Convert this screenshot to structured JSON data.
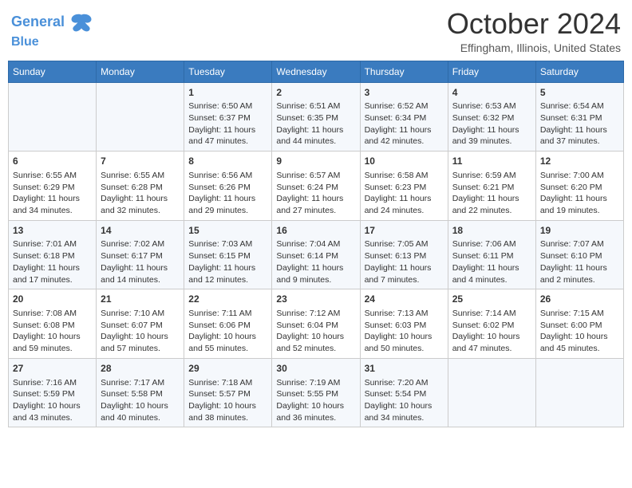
{
  "header": {
    "logo_line1": "General",
    "logo_line2": "Blue",
    "month_title": "October 2024",
    "location": "Effingham, Illinois, United States"
  },
  "days_of_week": [
    "Sunday",
    "Monday",
    "Tuesday",
    "Wednesday",
    "Thursday",
    "Friday",
    "Saturday"
  ],
  "weeks": [
    [
      {
        "day": "",
        "data": ""
      },
      {
        "day": "",
        "data": ""
      },
      {
        "day": "1",
        "data": "Sunrise: 6:50 AM\nSunset: 6:37 PM\nDaylight: 11 hours and 47 minutes."
      },
      {
        "day": "2",
        "data": "Sunrise: 6:51 AM\nSunset: 6:35 PM\nDaylight: 11 hours and 44 minutes."
      },
      {
        "day": "3",
        "data": "Sunrise: 6:52 AM\nSunset: 6:34 PM\nDaylight: 11 hours and 42 minutes."
      },
      {
        "day": "4",
        "data": "Sunrise: 6:53 AM\nSunset: 6:32 PM\nDaylight: 11 hours and 39 minutes."
      },
      {
        "day": "5",
        "data": "Sunrise: 6:54 AM\nSunset: 6:31 PM\nDaylight: 11 hours and 37 minutes."
      }
    ],
    [
      {
        "day": "6",
        "data": "Sunrise: 6:55 AM\nSunset: 6:29 PM\nDaylight: 11 hours and 34 minutes."
      },
      {
        "day": "7",
        "data": "Sunrise: 6:55 AM\nSunset: 6:28 PM\nDaylight: 11 hours and 32 minutes."
      },
      {
        "day": "8",
        "data": "Sunrise: 6:56 AM\nSunset: 6:26 PM\nDaylight: 11 hours and 29 minutes."
      },
      {
        "day": "9",
        "data": "Sunrise: 6:57 AM\nSunset: 6:24 PM\nDaylight: 11 hours and 27 minutes."
      },
      {
        "day": "10",
        "data": "Sunrise: 6:58 AM\nSunset: 6:23 PM\nDaylight: 11 hours and 24 minutes."
      },
      {
        "day": "11",
        "data": "Sunrise: 6:59 AM\nSunset: 6:21 PM\nDaylight: 11 hours and 22 minutes."
      },
      {
        "day": "12",
        "data": "Sunrise: 7:00 AM\nSunset: 6:20 PM\nDaylight: 11 hours and 19 minutes."
      }
    ],
    [
      {
        "day": "13",
        "data": "Sunrise: 7:01 AM\nSunset: 6:18 PM\nDaylight: 11 hours and 17 minutes."
      },
      {
        "day": "14",
        "data": "Sunrise: 7:02 AM\nSunset: 6:17 PM\nDaylight: 11 hours and 14 minutes."
      },
      {
        "day": "15",
        "data": "Sunrise: 7:03 AM\nSunset: 6:15 PM\nDaylight: 11 hours and 12 minutes."
      },
      {
        "day": "16",
        "data": "Sunrise: 7:04 AM\nSunset: 6:14 PM\nDaylight: 11 hours and 9 minutes."
      },
      {
        "day": "17",
        "data": "Sunrise: 7:05 AM\nSunset: 6:13 PM\nDaylight: 11 hours and 7 minutes."
      },
      {
        "day": "18",
        "data": "Sunrise: 7:06 AM\nSunset: 6:11 PM\nDaylight: 11 hours and 4 minutes."
      },
      {
        "day": "19",
        "data": "Sunrise: 7:07 AM\nSunset: 6:10 PM\nDaylight: 11 hours and 2 minutes."
      }
    ],
    [
      {
        "day": "20",
        "data": "Sunrise: 7:08 AM\nSunset: 6:08 PM\nDaylight: 10 hours and 59 minutes."
      },
      {
        "day": "21",
        "data": "Sunrise: 7:10 AM\nSunset: 6:07 PM\nDaylight: 10 hours and 57 minutes."
      },
      {
        "day": "22",
        "data": "Sunrise: 7:11 AM\nSunset: 6:06 PM\nDaylight: 10 hours and 55 minutes."
      },
      {
        "day": "23",
        "data": "Sunrise: 7:12 AM\nSunset: 6:04 PM\nDaylight: 10 hours and 52 minutes."
      },
      {
        "day": "24",
        "data": "Sunrise: 7:13 AM\nSunset: 6:03 PM\nDaylight: 10 hours and 50 minutes."
      },
      {
        "day": "25",
        "data": "Sunrise: 7:14 AM\nSunset: 6:02 PM\nDaylight: 10 hours and 47 minutes."
      },
      {
        "day": "26",
        "data": "Sunrise: 7:15 AM\nSunset: 6:00 PM\nDaylight: 10 hours and 45 minutes."
      }
    ],
    [
      {
        "day": "27",
        "data": "Sunrise: 7:16 AM\nSunset: 5:59 PM\nDaylight: 10 hours and 43 minutes."
      },
      {
        "day": "28",
        "data": "Sunrise: 7:17 AM\nSunset: 5:58 PM\nDaylight: 10 hours and 40 minutes."
      },
      {
        "day": "29",
        "data": "Sunrise: 7:18 AM\nSunset: 5:57 PM\nDaylight: 10 hours and 38 minutes."
      },
      {
        "day": "30",
        "data": "Sunrise: 7:19 AM\nSunset: 5:55 PM\nDaylight: 10 hours and 36 minutes."
      },
      {
        "day": "31",
        "data": "Sunrise: 7:20 AM\nSunset: 5:54 PM\nDaylight: 10 hours and 34 minutes."
      },
      {
        "day": "",
        "data": ""
      },
      {
        "day": "",
        "data": ""
      }
    ]
  ]
}
